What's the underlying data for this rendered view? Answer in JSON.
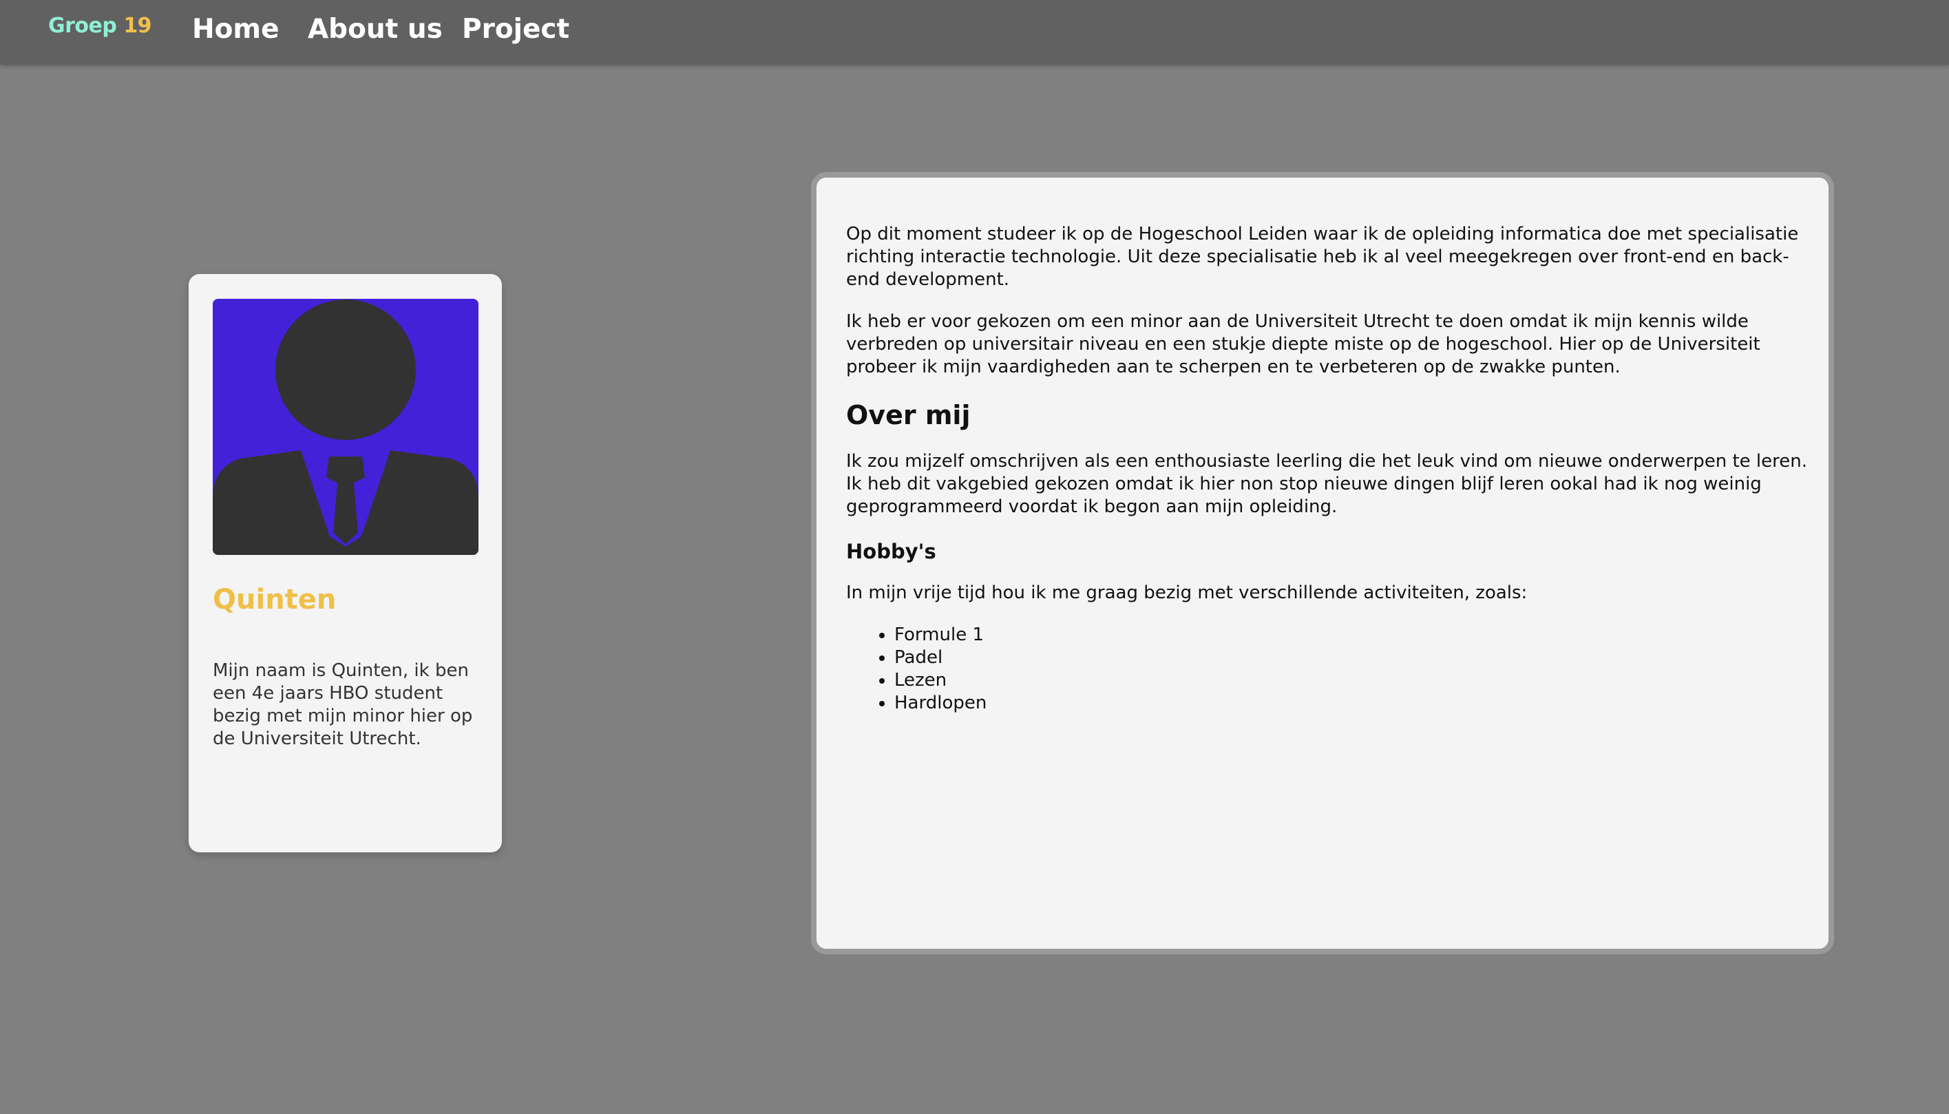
{
  "nav": {
    "logo_part1": "Groep",
    "logo_part2": "19",
    "links": [
      {
        "label": "Home"
      },
      {
        "label": "About us"
      },
      {
        "label": "Project"
      }
    ]
  },
  "profile": {
    "name": "Quinten",
    "bio": "Mijn naam is Quinten, ik ben een 4e jaars HBO student bezig met mijn minor hier op de Universiteit Utrecht."
  },
  "content": {
    "intro_paragraphs": [
      "Op dit moment studeer ik op de Hogeschool Leiden waar ik de opleiding informatica doe met specialisatie richting interactie technologie. Uit deze specialisatie heb ik al veel meegekregen over front-end en back-end development.",
      "Ik heb er voor gekozen om een minor aan de Universiteit Utrecht te doen omdat ik mijn kennis wilde verbreden op universitair niveau en een stukje diepte miste op de hogeschool. Hier op de Universiteit probeer ik mijn vaardigheden aan te scherpen en te verbeteren op de zwakke punten."
    ],
    "about_heading": "Over mij",
    "about_paragraph": "Ik zou mijzelf omschrijven als een enthousiaste leerling die het leuk vind om nieuwe onderwerpen te leren. Ik heb dit vakgebied gekozen omdat ik hier non stop nieuwe dingen blijf leren ookal had ik nog weinig geprogrammeerd voordat ik begon aan mijn opleiding.",
    "hobbies_heading": "Hobby's",
    "hobbies_intro": "In mijn vrije tijd hou ik me graag bezig met verschillende activiteiten, zoals:",
    "hobbies": [
      "Formule 1",
      "Padel",
      "Lezen",
      "Hardlopen"
    ]
  },
  "colors": {
    "background": "#808080",
    "navbar": "#616161",
    "logo_part1": "#8ff0d4",
    "logo_part2": "#f2c04d",
    "accent_name": "#f0bf48",
    "avatar_bg": "#4321d9",
    "card": "#f4f4f4"
  },
  "icons": {
    "avatar": "person-silhouette-icon"
  }
}
